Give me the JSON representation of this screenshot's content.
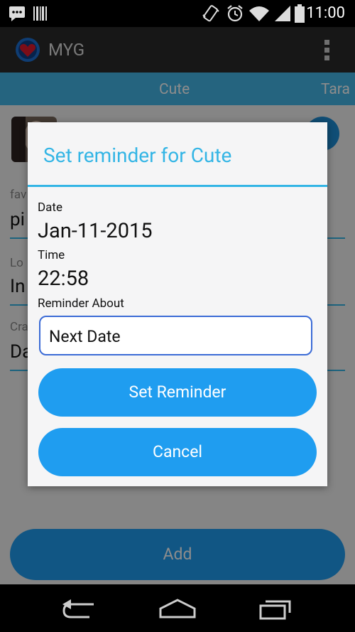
{
  "status_bar": {
    "time": "11:00"
  },
  "app": {
    "title": "MYG"
  },
  "tabs": [
    {
      "label": "Cute"
    },
    {
      "label": "Tara"
    }
  ],
  "background_fields": {
    "field1_label": "fav",
    "field1_value": "pi",
    "field2_label": "Lo",
    "field2_value": "In",
    "field3_label": "Cra",
    "field3_value": "Da",
    "add_button_label": "Add"
  },
  "dialog": {
    "title": "Set reminder for  Cute",
    "date_label": "Date",
    "date_value": "Jan-11-2015",
    "time_label": "Time",
    "time_value": "22:58",
    "reminder_label": "Reminder About",
    "reminder_value": "Next Date",
    "set_button": "Set Reminder",
    "cancel_button": "Cancel"
  },
  "icons": {
    "status_left": [
      "chat-icon",
      "barcode-icon"
    ],
    "status_right": [
      "vibrate-icon",
      "alarm-icon",
      "wifi-icon",
      "signal-icon",
      "battery-icon"
    ],
    "nav": [
      "back-icon",
      "home-icon",
      "recents-icon"
    ]
  },
  "colors": {
    "accent": "#33b5e5",
    "button": "#1f9df0",
    "tab_bar": "#44b6e8"
  }
}
